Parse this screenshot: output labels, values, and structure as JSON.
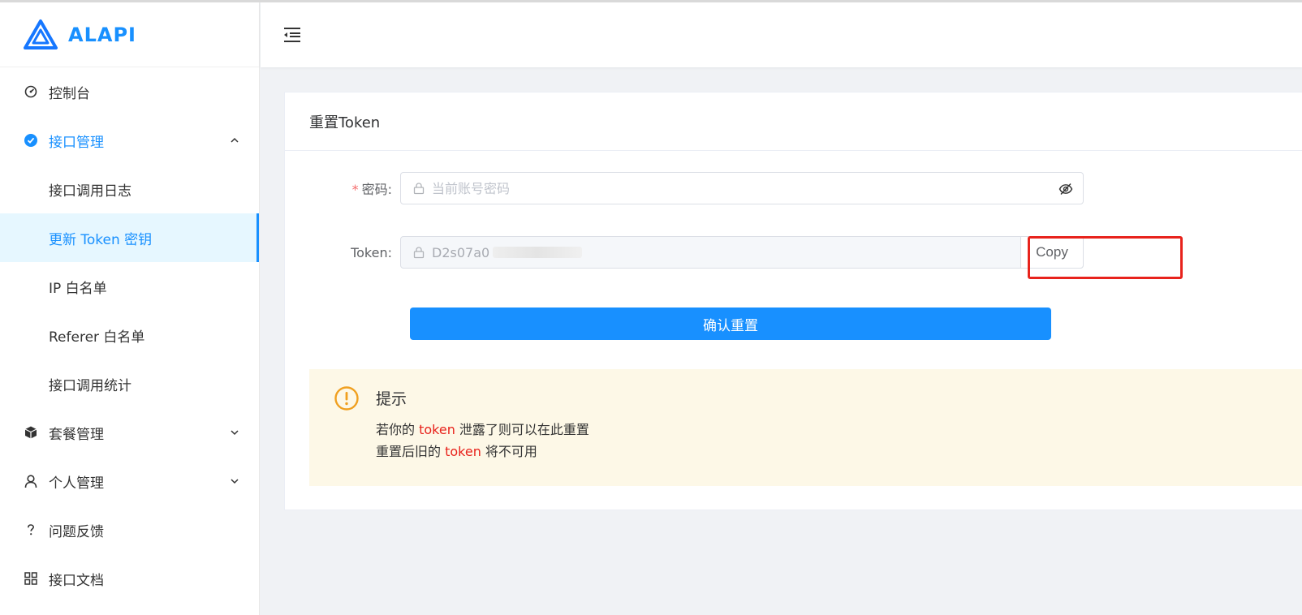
{
  "brand": {
    "name": "ALAPI",
    "color": "#1890ff"
  },
  "sidebar": {
    "items": [
      {
        "label": "控制台",
        "icon": "dashboard-icon"
      },
      {
        "label": "接口管理",
        "icon": "check-circle-icon",
        "expanded": true,
        "children": [
          {
            "label": "接口调用日志"
          },
          {
            "label": "更新 Token 密钥",
            "active": true
          },
          {
            "label": "IP 白名单"
          },
          {
            "label": "Referer 白名单"
          },
          {
            "label": "接口调用统计"
          }
        ]
      },
      {
        "label": "套餐管理",
        "icon": "cube-icon",
        "expanded": false
      },
      {
        "label": "个人管理",
        "icon": "user-icon",
        "expanded": false
      },
      {
        "label": "问题反馈",
        "icon": "question-icon"
      },
      {
        "label": "接口文档",
        "icon": "grid-icon"
      }
    ]
  },
  "header": {
    "toggle_icon": "menu-fold-icon"
  },
  "card": {
    "title": "重置Token",
    "password": {
      "required_mark": "*",
      "label": "密码:",
      "placeholder": "当前账号密码",
      "value": ""
    },
    "token": {
      "label": "Token:",
      "value": "D2s07a0",
      "copy_label": "Copy"
    },
    "submit_label": "确认重置",
    "alert": {
      "title": "提示",
      "line1_pre": "若你的 ",
      "line1_hl": "token",
      "line1_post": " 泄露了则可以在此重置",
      "line2_pre": "重置后旧的 ",
      "line2_hl": "token",
      "line2_post": " 将不可用"
    }
  },
  "colors": {
    "primary": "#1890ff",
    "highlight": "#e8231c",
    "alert_bg": "#fdf8e7",
    "warning": "#f0a020"
  }
}
